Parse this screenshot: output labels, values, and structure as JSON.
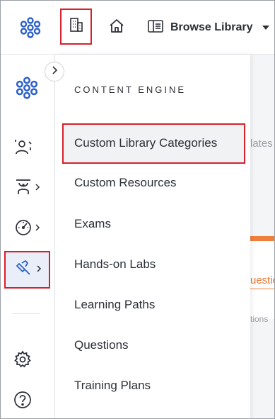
{
  "topbar": {
    "browse_label": "Browse Library"
  },
  "flyout": {
    "section_title": "CONTENT ENGINE",
    "items": [
      {
        "label": "Custom Library Categories",
        "selected": true
      },
      {
        "label": "Custom Resources"
      },
      {
        "label": "Exams"
      },
      {
        "label": "Hands-on Labs"
      },
      {
        "label": "Learning Paths"
      },
      {
        "label": "Questions"
      },
      {
        "label": "Training Plans"
      }
    ]
  },
  "background": {
    "fragment_1": "lates",
    "fragment_2": "uestic",
    "fragment_3": "tions"
  },
  "icons": {
    "logo": "logo-icon",
    "building": "building-icon",
    "home": "home-icon",
    "browse": "book-icon",
    "users": "users-icon",
    "instructor": "instructor-icon",
    "gauge": "gauge-icon",
    "paintbrush": "paintbrush-icon",
    "settings": "gear-icon",
    "help": "help-icon"
  },
  "colors": {
    "brand": "#2c61c9",
    "highlight": "#d6202c",
    "accent": "#f07f3c"
  }
}
